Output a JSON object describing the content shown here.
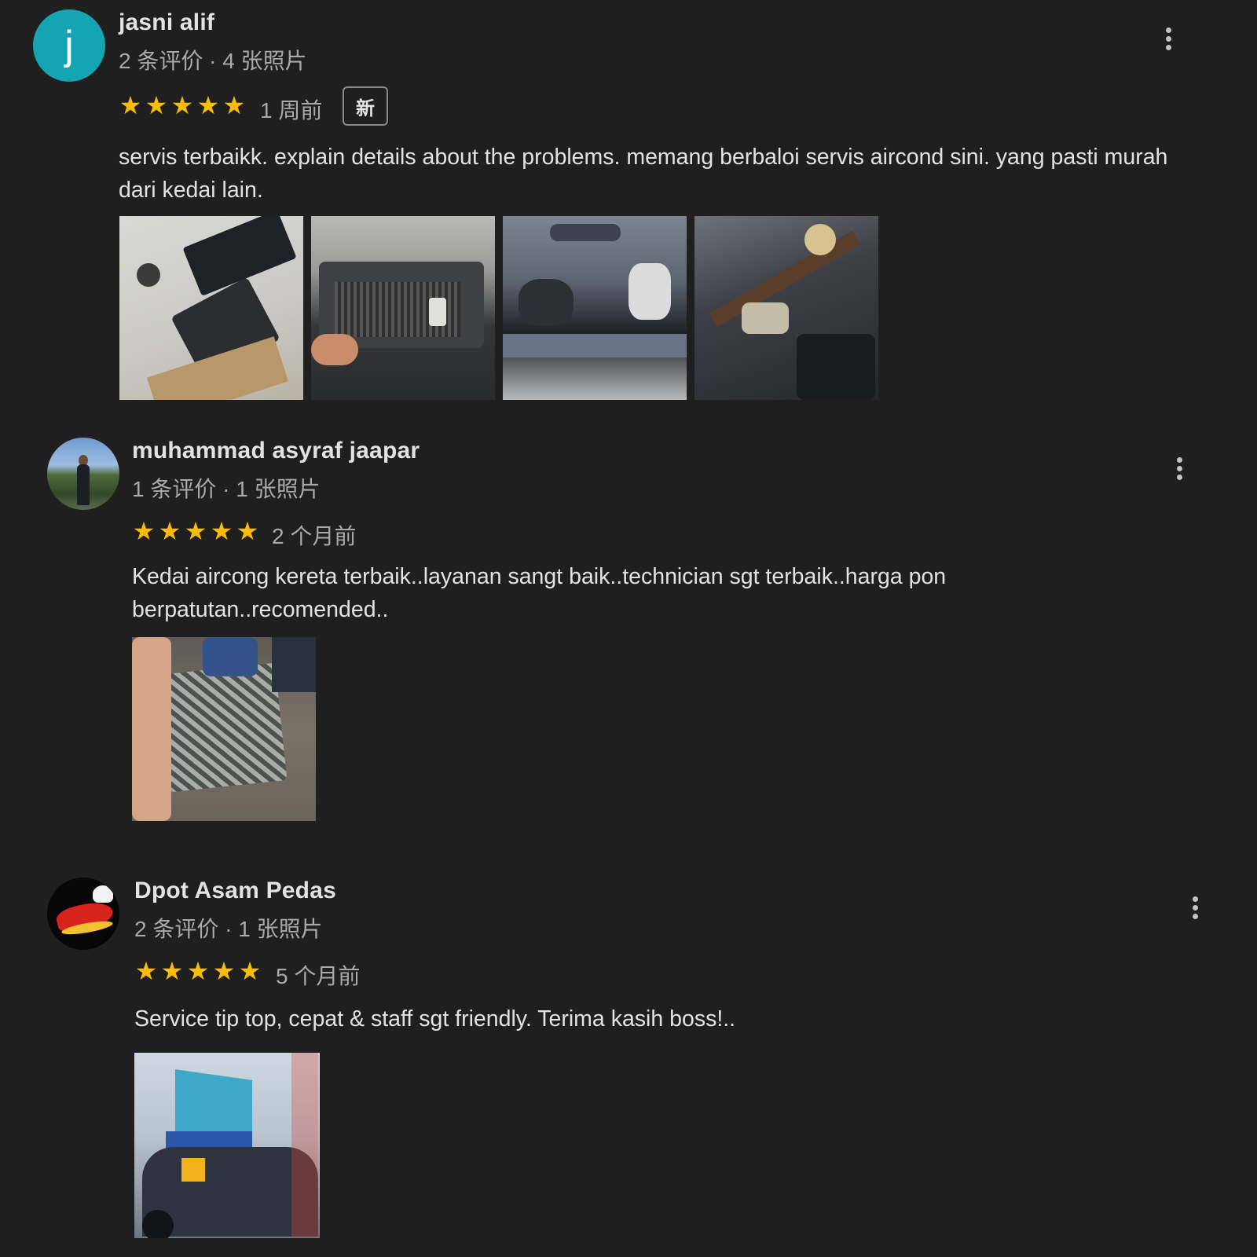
{
  "reviews": [
    {
      "avatar_letter": "j",
      "name": "jasni alif",
      "meta": "2 条评价 · 4 张照片",
      "rating": 5,
      "time": "1 周前",
      "badge": "新",
      "text": "servis terbaikk. explain details about the problems. memang berbaloi servis aircond sini. yang pasti murah dari kedai lain.",
      "photo_count": 4
    },
    {
      "avatar_letter": "",
      "name": "muhammad asyraf jaapar",
      "meta": "1 条评价 · 1 张照片",
      "rating": 5,
      "time": "2 个月前",
      "badge": "",
      "text": "Kedai aircong kereta terbaik..layanan sangt baik..technician sgt terbaik..harga pon berpatutan..recomended..",
      "photo_count": 1
    },
    {
      "avatar_letter": "",
      "name": "Dpot Asam Pedas",
      "meta": "2 条评价 · 1 张照片",
      "rating": 5,
      "time": "5 个月前",
      "badge": "",
      "text": "Service tip top, cepat & staff sgt friendly. Terima kasih boss!..",
      "photo_count": 1
    }
  ],
  "colors": {
    "background": "#1f1f1f",
    "star": "#fbbc04",
    "avatar_teal": "#14a4b2",
    "text": "#e3e3e3",
    "muted": "#aaaaaa"
  },
  "icons": {
    "star": "star-icon",
    "more": "more-vert-icon"
  }
}
